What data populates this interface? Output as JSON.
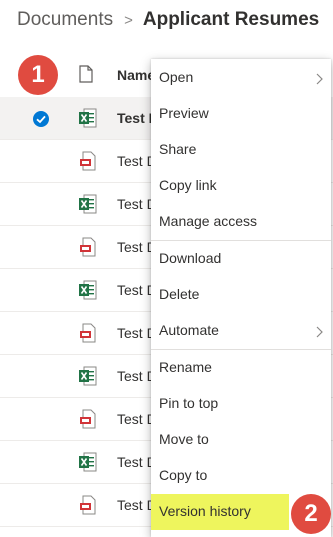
{
  "breadcrumb": {
    "root": "Documents",
    "separator": ">",
    "current": "Applicant Resumes"
  },
  "list": {
    "file_type_icon": "document-outline-icon",
    "name_header": "Name",
    "rows": [
      {
        "name": "Test D",
        "type": "excel",
        "selected": true
      },
      {
        "name": "Test D",
        "type": "pdf",
        "selected": false
      },
      {
        "name": "Test D",
        "type": "excel",
        "selected": false
      },
      {
        "name": "Test D",
        "type": "pdf",
        "selected": false
      },
      {
        "name": "Test D",
        "type": "excel",
        "selected": false
      },
      {
        "name": "Test D",
        "type": "pdf",
        "selected": false
      },
      {
        "name": "Test D",
        "type": "excel",
        "selected": false
      },
      {
        "name": "Test D",
        "type": "pdf",
        "selected": false
      },
      {
        "name": "Test D",
        "type": "excel",
        "selected": false
      },
      {
        "name": "Test D",
        "type": "pdf",
        "selected": false
      }
    ]
  },
  "context_menu": {
    "items": [
      {
        "label": "Open",
        "submenu": true
      },
      {
        "label": "Preview"
      },
      {
        "label": "Share"
      },
      {
        "label": "Copy link"
      },
      {
        "label": "Manage access"
      },
      {
        "label": "Download"
      },
      {
        "label": "Delete"
      },
      {
        "label": "Automate",
        "submenu": true
      },
      {
        "label": "Rename"
      },
      {
        "label": "Pin to top"
      },
      {
        "label": "Move to"
      },
      {
        "label": "Copy to"
      },
      {
        "label": "Version history",
        "highlighted": true
      }
    ]
  },
  "annotations": {
    "step1": "1",
    "step2": "2"
  },
  "colors": {
    "accent": "#0078d4",
    "excel": "#217346",
    "pdf": "#d13438",
    "highlight": "#eef55d",
    "badge": "#e04b40"
  }
}
